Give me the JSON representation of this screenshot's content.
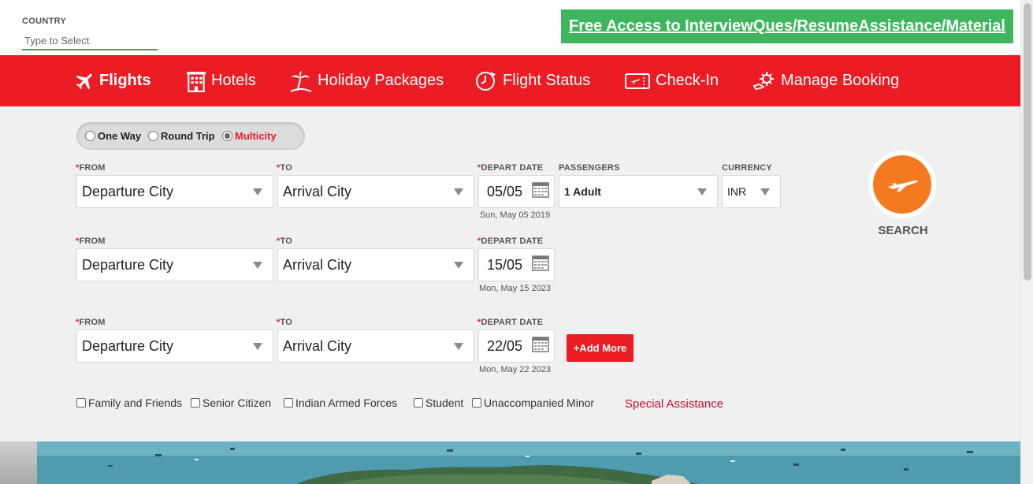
{
  "topbar": {
    "country_label": "COUNTRY",
    "country_placeholder": "Type to Select",
    "promo_text": "Free Access to InterviewQues/ResumeAssistance/Material"
  },
  "nav": {
    "items": [
      {
        "label": "Flights",
        "icon": "airplane-icon",
        "active": true
      },
      {
        "label": "Hotels",
        "icon": "hotel-building-icon"
      },
      {
        "label": "Holiday Packages",
        "icon": "palm-tree-icon"
      },
      {
        "label": "Flight Status",
        "icon": "clock-plane-icon"
      },
      {
        "label": "Check-In",
        "icon": "boarding-pass-icon"
      },
      {
        "label": "Manage Booking",
        "icon": "gear-hand-icon"
      }
    ]
  },
  "trip_type": {
    "options": [
      "One Way",
      "Round Trip",
      "Multicity"
    ],
    "selected": "Multicity"
  },
  "labels": {
    "from": "FROM",
    "to": "TO",
    "depart_date": "DEPART DATE",
    "passengers": "PASSENGERS",
    "currency": "CURRENCY",
    "required_mark": "*"
  },
  "legs": [
    {
      "from": "Departure City",
      "to": "Arrival City",
      "date": "05/05",
      "date_long": "Sun, May 05 2019"
    },
    {
      "from": "Departure City",
      "to": "Arrival City",
      "date": "15/05",
      "date_long": "Mon, May 15 2023"
    },
    {
      "from": "Departure City",
      "to": "Arrival City",
      "date": "22/05",
      "date_long": "Mon, May 22 2023"
    }
  ],
  "passengers_value": "1 Adult",
  "currency_value": "INR",
  "add_more_label": "+Add More",
  "search_label": "SEARCH",
  "concessions": [
    "Family and Friends",
    "Senior Citizen",
    "Indian Armed Forces",
    "Student",
    "Unaccompanied Minor"
  ],
  "special_assistance": "Special Assistance",
  "colors": {
    "brand_red": "#ec1c24",
    "promo_green": "#3db65d",
    "search_orange": "#f47920",
    "panel_bg": "#f0f0f0"
  }
}
